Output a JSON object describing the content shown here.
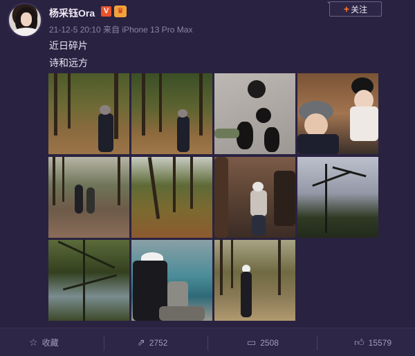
{
  "post": {
    "username": "杨采钰Ora",
    "v_badge": "V",
    "crown_badge": "♛",
    "meta": "21-12-5 20:10 来自 iPhone 13 Pro Max",
    "follow_label": "关注",
    "dropdown_icon": "⌄",
    "text_line1": "近日碎片",
    "text_line2": "诗和远方"
  },
  "actions": {
    "favorite_label": "收藏",
    "repost_count": "2752",
    "comment_count": "2508",
    "like_count": "15579"
  },
  "icons": {
    "favorite": "star-icon",
    "repost": "repost-icon",
    "comment": "comment-icon",
    "like": "thumbs-up-icon"
  },
  "colors": {
    "background": "#2a2241",
    "follow_plus": "#ff7a2a",
    "v_badge": "#e8532d",
    "meta_text": "#8c86a3"
  }
}
